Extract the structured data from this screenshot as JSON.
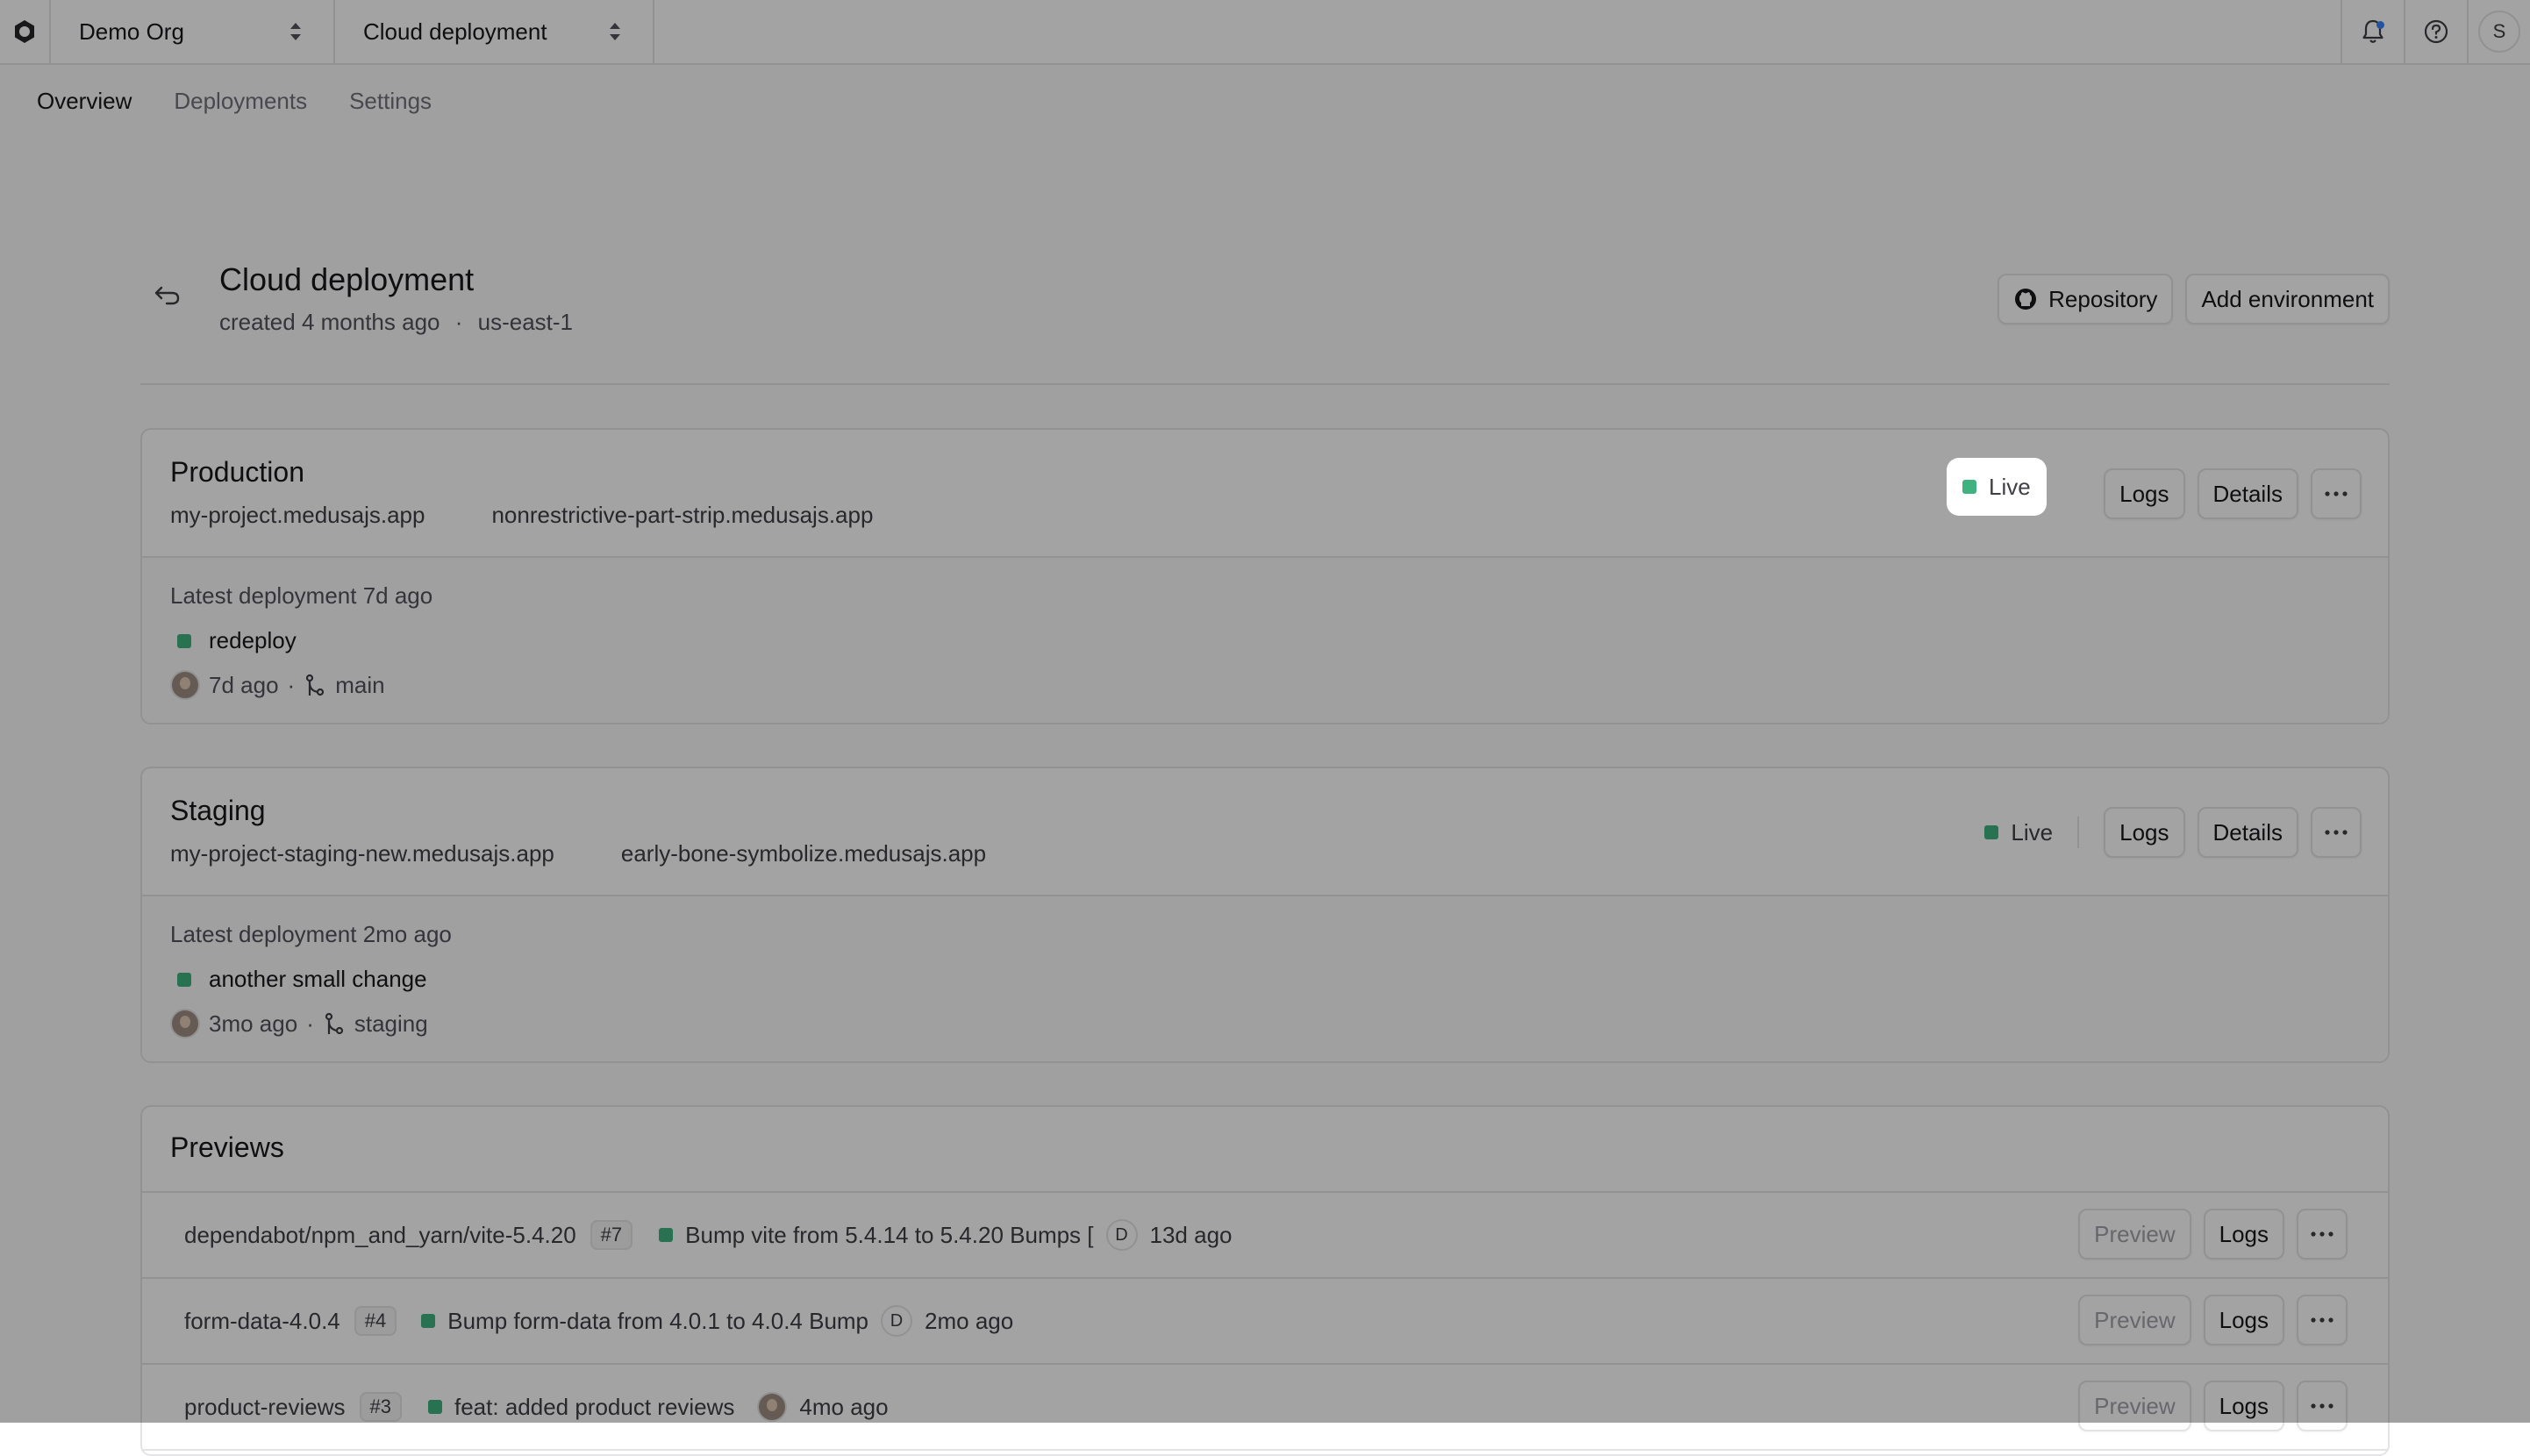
{
  "topbar": {
    "org": "Demo Org",
    "project": "Cloud deployment",
    "avatar_initial": "S"
  },
  "tabs": [
    {
      "label": "Overview"
    },
    {
      "label": "Deployments"
    },
    {
      "label": "Settings"
    }
  ],
  "header": {
    "title": "Cloud deployment",
    "created": "created 4 months ago",
    "dot_separator": "·",
    "region": "us-east-1",
    "repository_label": "Repository",
    "add_environment_label": "Add environment"
  },
  "environments": [
    {
      "name": "Production",
      "domains": [
        "my-project.medusajs.app",
        "nonrestrictive-part-strip.medusajs.app"
      ],
      "status": "Live",
      "logs_label": "Logs",
      "details_label": "Details",
      "latest_deployment": "Latest deployment 7d ago",
      "commit_message": "redeploy",
      "commit_age": "7d ago",
      "branch": "main"
    },
    {
      "name": "Staging",
      "domains": [
        "my-project-staging-new.medusajs.app",
        "early-bone-symbolize.medusajs.app"
      ],
      "status": "Live",
      "logs_label": "Logs",
      "details_label": "Details",
      "latest_deployment": "Latest deployment 2mo ago",
      "commit_message": "another small change",
      "commit_age": "3mo ago",
      "branch": "staging"
    }
  ],
  "previews": {
    "title": "Previews",
    "preview_label": "Preview",
    "logs_label": "Logs",
    "rows": [
      {
        "branch": "dependabot/npm_and_yarn/vite-5.4.20",
        "pr": "#7",
        "message": "Bump vite from 5.4.14 to 5.4.20 Bumps [",
        "author_initial": "D",
        "age": "13d ago"
      },
      {
        "branch": "form-data-4.0.4",
        "pr": "#4",
        "message": "Bump form-data from 4.0.1 to 4.0.4 Bump",
        "author_initial": "D",
        "age": "2mo ago"
      },
      {
        "branch": "product-reviews",
        "pr": "#3",
        "message": "feat: added product reviews",
        "author_initial": "",
        "age": "4mo ago"
      }
    ]
  },
  "colors": {
    "live_dot": "#3fb27f",
    "notification_dot": "#3b82f6",
    "overlay": "rgba(0,0,0,0.36)"
  }
}
